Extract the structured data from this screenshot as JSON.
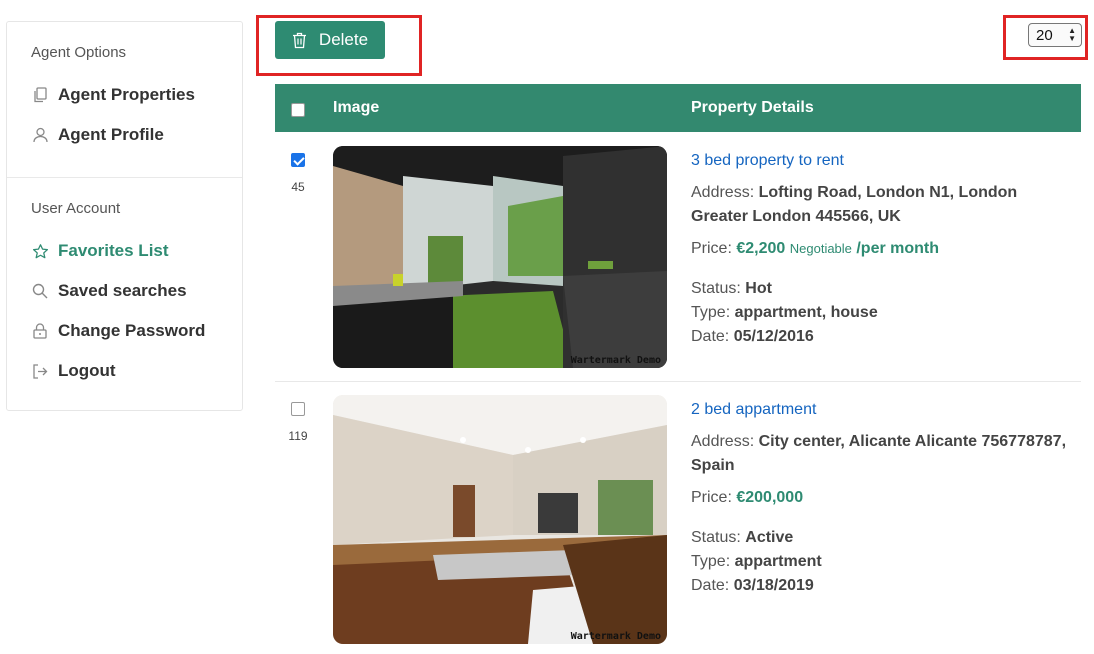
{
  "sidebar": {
    "agent_heading": "Agent Options",
    "agent_items": [
      {
        "label": "Agent Properties",
        "icon": "copy-icon"
      },
      {
        "label": "Agent Profile",
        "icon": "user-icon"
      }
    ],
    "user_heading": "User Account",
    "user_items": [
      {
        "label": "Favorites List",
        "icon": "star-icon",
        "active": true
      },
      {
        "label": "Saved searches",
        "icon": "search-icon"
      },
      {
        "label": "Change Password",
        "icon": "lock-icon"
      },
      {
        "label": "Logout",
        "icon": "logout-icon"
      }
    ]
  },
  "toolbar": {
    "delete_label": "Delete",
    "per_page": "20"
  },
  "table": {
    "headers": {
      "image": "Image",
      "details": "Property Details"
    },
    "rows": [
      {
        "id": "45",
        "checked": true,
        "title": "3 bed property to rent",
        "address_label": "Address:",
        "address": "Lofting Road, London N1, London Greater London 445566, UK",
        "price_label": "Price:",
        "price": "€2,200",
        "negotiable": "Negotiable",
        "per": "/per month",
        "status_label": "Status:",
        "status": "Hot",
        "type_label": "Type:",
        "type": "appartment, house",
        "date_label": "Date:",
        "date": "05/12/2016",
        "watermark": "Wartermark Demo"
      },
      {
        "id": "119",
        "checked": false,
        "title": "2 bed appartment",
        "address_label": "Address:",
        "address": "City center, Alicante Alicante 756778787, Spain",
        "price_label": "Price:",
        "price": "€200,000",
        "status_label": "Status:",
        "status": "Active",
        "type_label": "Type:",
        "type": "appartment",
        "date_label": "Date:",
        "date": "03/18/2019",
        "watermark": "Wartermark Demo"
      }
    ]
  },
  "colors": {
    "accent": "#2e8b72",
    "header": "#33896f",
    "link": "#1565c0",
    "highlight": "#e02424"
  }
}
